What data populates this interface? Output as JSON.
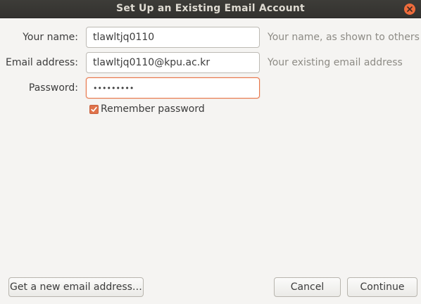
{
  "window": {
    "title": "Set Up an Existing Email Account"
  },
  "form": {
    "name": {
      "label": "Your name:",
      "value": "tlawltjq0110",
      "hint": "Your name, as shown to others"
    },
    "email": {
      "label": "Email address:",
      "value": "tlawltjq0110@kpu.ac.kr",
      "hint": "Your existing email address"
    },
    "password": {
      "label": "Password:",
      "value": "•••••••••"
    },
    "remember": {
      "label": "Remember password",
      "checked": true
    }
  },
  "buttons": {
    "new_address": "Get a new email address…",
    "cancel": "Cancel",
    "continue": "Continue"
  },
  "colors": {
    "accent": "#e0734b",
    "titlebar": "#3d3c38",
    "background": "#f5f4f2"
  }
}
